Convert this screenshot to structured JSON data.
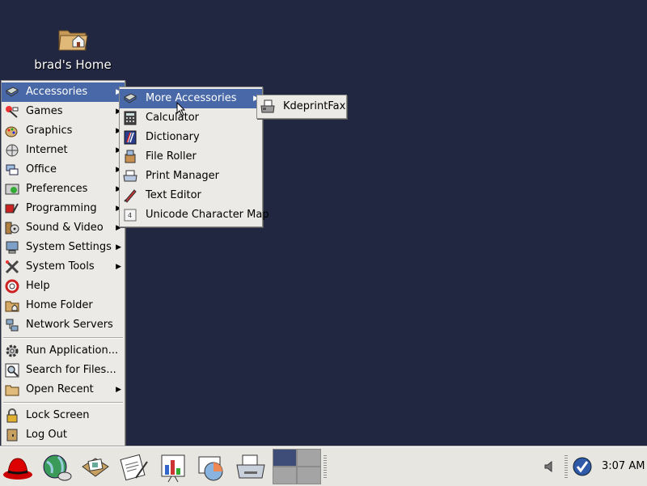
{
  "desktop": {
    "home_icon_label": "brad's Home"
  },
  "main_menu": {
    "items": [
      {
        "label": "Accessories",
        "icon": "accessories-icon",
        "submenu": true,
        "active": true
      },
      {
        "label": "Games",
        "icon": "games-icon",
        "submenu": true
      },
      {
        "label": "Graphics",
        "icon": "graphics-icon",
        "submenu": true
      },
      {
        "label": "Internet",
        "icon": "internet-icon",
        "submenu": true
      },
      {
        "label": "Office",
        "icon": "office-icon",
        "submenu": true
      },
      {
        "label": "Preferences",
        "icon": "preferences-icon",
        "submenu": true
      },
      {
        "label": "Programming",
        "icon": "programming-icon",
        "submenu": true
      },
      {
        "label": "Sound & Video",
        "icon": "sound-video-icon",
        "submenu": true
      },
      {
        "label": "System Settings",
        "icon": "system-settings-icon",
        "submenu": true
      },
      {
        "label": "System Tools",
        "icon": "system-tools-icon",
        "submenu": true
      },
      {
        "label": "Help",
        "icon": "help-icon"
      },
      {
        "label": "Home Folder",
        "icon": "home-folder-icon"
      },
      {
        "label": "Network Servers",
        "icon": "network-servers-icon"
      },
      {
        "label": "Run Application...",
        "icon": "run-application-icon"
      },
      {
        "label": "Search for Files...",
        "icon": "search-files-icon"
      },
      {
        "label": "Open Recent",
        "icon": "open-recent-icon",
        "submenu": true
      },
      {
        "label": "Lock Screen",
        "icon": "lock-icon"
      },
      {
        "label": "Log Out",
        "icon": "log-out-icon"
      }
    ]
  },
  "accessories_menu": {
    "items": [
      {
        "label": "More Accessories",
        "icon": "accessories-icon",
        "submenu": true,
        "active": true
      },
      {
        "label": "Calculator",
        "icon": "calculator-icon"
      },
      {
        "label": "Dictionary",
        "icon": "dictionary-icon"
      },
      {
        "label": "File Roller",
        "icon": "file-roller-icon"
      },
      {
        "label": "Print Manager",
        "icon": "print-manager-icon"
      },
      {
        "label": "Text Editor",
        "icon": "text-editor-icon"
      },
      {
        "label": "Unicode Character Map",
        "icon": "character-map-icon"
      }
    ]
  },
  "more_accessories_menu": {
    "items": [
      {
        "label": "KdeprintFax",
        "icon": "fax-icon"
      }
    ]
  },
  "panel": {
    "launchers": [
      "redhat-main-menu-icon",
      "web-browser-icon",
      "email-icon",
      "word-processor-icon",
      "presentation-icon",
      "spreadsheet-icon",
      "print-manager-icon"
    ],
    "clock": "3:07 AM",
    "colors": {
      "desktop": "#212741",
      "highlight": "#4968a8",
      "workspace_active": "#3d4d78"
    }
  }
}
